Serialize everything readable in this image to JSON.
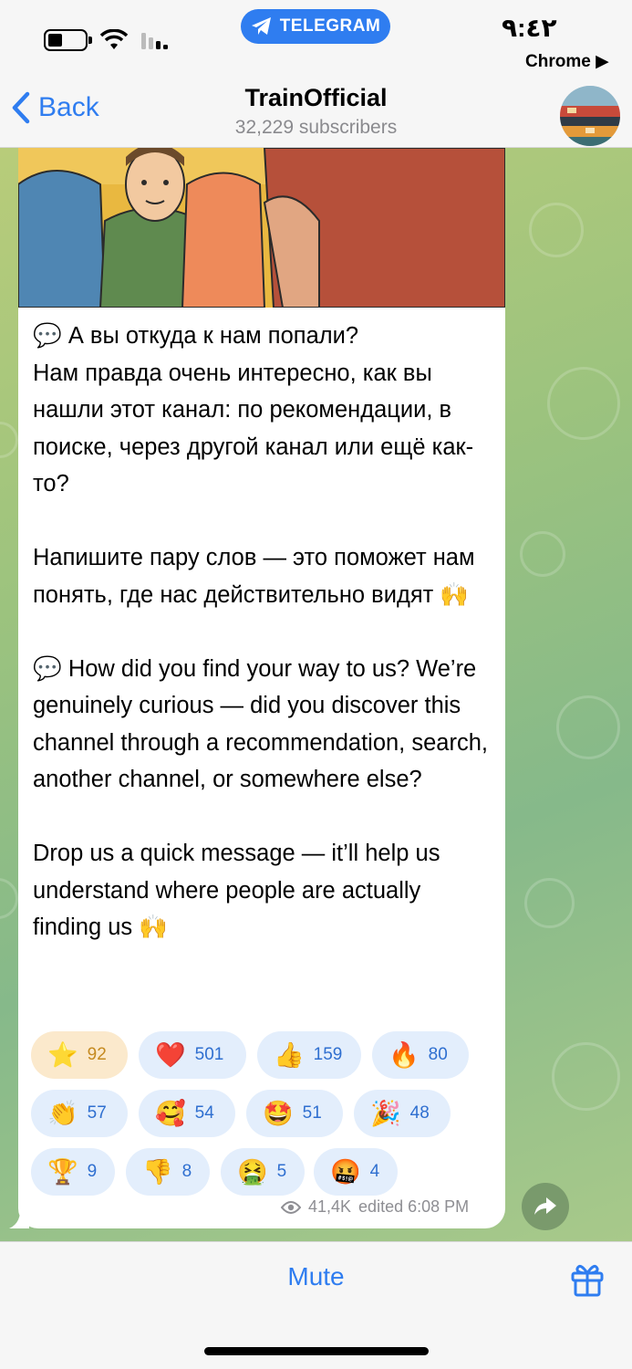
{
  "status_bar": {
    "pill_label": "TELEGRAM",
    "time": "٩:٤٢",
    "back_to_app": "Chrome ▶"
  },
  "header": {
    "back_label": "Back",
    "title": "TrainOfficial",
    "subtitle": "32,229 subscribers"
  },
  "message": {
    "text": "💬 А вы откуда к нам попали?\nНам правда очень интересно, как вы нашли этот канал: по рекомендации, в поиске, через другой канал или ещё как-то?\n\nНапишите пару слов — это поможет нам понять, где нас действительно видят 🙌\n\n💬 How did you find your way to us? We’re genuinely curious — did you discover this channel through a recommendation, search, another channel, or somewhere else?\n\nDrop us a quick message — it’ll help us understand where people are actually finding us 🙌",
    "views": "41,4K",
    "edited_time": "edited 6:08 PM",
    "reactions": [
      {
        "emoji": "⭐",
        "count": "92"
      },
      {
        "emoji": "❤️",
        "count": "501"
      },
      {
        "emoji": "👍",
        "count": "159"
      },
      {
        "emoji": "🔥",
        "count": "80"
      },
      {
        "emoji": "👏",
        "count": "57"
      },
      {
        "emoji": "🥰",
        "count": "54"
      },
      {
        "emoji": "🤩",
        "count": "51"
      },
      {
        "emoji": "🎉",
        "count": "48"
      },
      {
        "emoji": "🏆",
        "count": "9"
      },
      {
        "emoji": "👎",
        "count": "8"
      },
      {
        "emoji": "🤮",
        "count": "5"
      },
      {
        "emoji": "🤬",
        "count": "4"
      }
    ]
  },
  "bottom_bar": {
    "mute_label": "Mute"
  },
  "colors": {
    "accent": "#2f7df0",
    "reaction_bg": "#e3eefc",
    "star_reaction_bg": "#fbe9cc"
  },
  "icons": [
    "telegram-plane-icon",
    "battery-icon",
    "wifi-icon",
    "signal-icon",
    "chevron-left-icon",
    "eye-icon",
    "share-icon",
    "gift-icon"
  ]
}
